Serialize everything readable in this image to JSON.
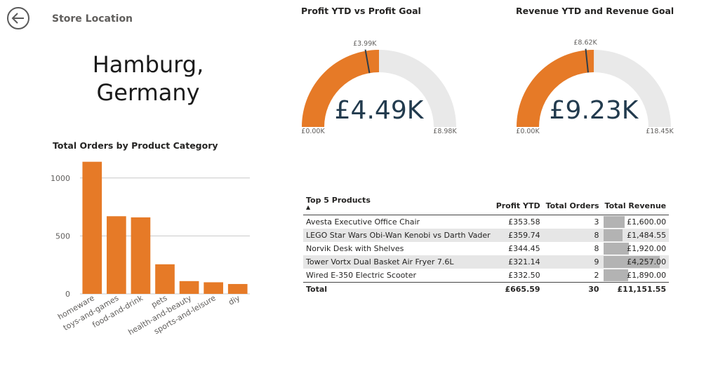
{
  "header": {
    "title": "Store Location"
  },
  "location": {
    "line1": "Hamburg,",
    "line2": "Germany"
  },
  "gauges": [
    {
      "title": "Profit YTD vs Profit Goal",
      "value": 4.49,
      "max": 8.98,
      "goal": 3.99,
      "value_label": "£4.49K",
      "min_label": "£0.00K",
      "max_label": "£8.98K",
      "goal_label": "£3.99K"
    },
    {
      "title": "Revenue YTD and Revenue Goal",
      "value": 9.23,
      "max": 18.45,
      "goal": 8.62,
      "value_label": "£9.23K",
      "min_label": "£0.00K",
      "max_label": "£18.45K",
      "goal_label": "£8.62K"
    }
  ],
  "colors": {
    "accent": "#e67a27",
    "track": "#e9e9e9",
    "needle": "#2e3d4a",
    "grid": "#c8c8c8",
    "rev_bar": "#b3b3b3"
  },
  "chart_data": {
    "type": "bar",
    "title": "Total Orders by Product Category",
    "categories": [
      "homeware",
      "toys-and-games",
      "food-and-drink",
      "pets",
      "health-and-beauty",
      "sports-and-leisure",
      "diy"
    ],
    "values": [
      1140,
      670,
      660,
      255,
      110,
      100,
      85
    ],
    "ylim": [
      0,
      1150
    ],
    "yticks": [
      0,
      500,
      1000
    ],
    "grid": true
  },
  "table": {
    "columns": [
      "Top 5 Products",
      "Profit YTD",
      "Total Orders",
      "Total Revenue"
    ],
    "sort_indicator": "▲",
    "rows": [
      {
        "product": "Avesta Executive Office Chair",
        "profit": "£353.58",
        "orders": "3",
        "revenue": "£1,600.00",
        "revenue_value": 1600
      },
      {
        "product": "LEGO Star Wars Obi-Wan Kenobi vs Darth Vader",
        "profit": "£359.74",
        "orders": "8",
        "revenue": "£1,484.55",
        "revenue_value": 1484.55
      },
      {
        "product": "Norvik Desk with Shelves",
        "profit": "£344.45",
        "orders": "8",
        "revenue": "£1,920.00",
        "revenue_value": 1920
      },
      {
        "product": "Tower Vortx Dual Basket Air Fryer 7.6L",
        "profit": "£321.14",
        "orders": "9",
        "revenue": "£4,257.00",
        "revenue_value": 4257
      },
      {
        "product": "Wired E-350 Electric Scooter",
        "profit": "£332.50",
        "orders": "2",
        "revenue": "£1,890.00",
        "revenue_value": 1890
      }
    ],
    "total": {
      "label": "Total",
      "profit": "£665.59",
      "orders": "30",
      "revenue": "£11,151.55"
    }
  }
}
